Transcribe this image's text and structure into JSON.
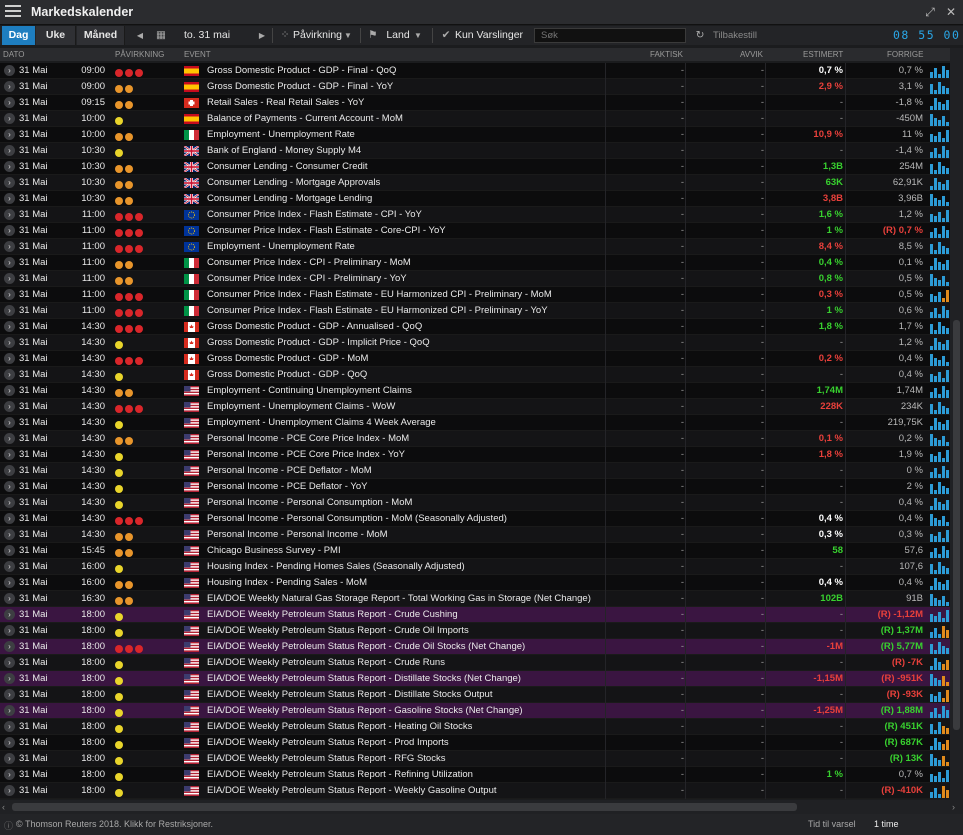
{
  "app": {
    "title": "Markedskalender"
  },
  "toolbar": {
    "views": [
      "Dag",
      "Uke",
      "Måned"
    ],
    "date": "to. 31 mai",
    "impact": "Påvirkning",
    "country": "Land",
    "alerts": "Kun Varslinger",
    "search_placeholder": "Søk",
    "reset": "Tilbakestill",
    "clock": "08 55 00"
  },
  "columns": {
    "date": "DATO",
    "impact": "PÅVIRKNING",
    "event": "EVENT",
    "actual": "FAKTISK",
    "deviation": "AVVIK",
    "estimate": "ESTIMERT",
    "previous": "FORRIGE"
  },
  "colors": {
    "high": "#d9262a",
    "medium": "#e8952b",
    "low": "#e9d52b",
    "positive": "#38d12f",
    "negative": "#e8403b",
    "accent": "#1e7ec0"
  },
  "rows": [
    {
      "date": "31 Mai",
      "time": "09:00",
      "impact": "high",
      "flag": "es",
      "event": "Gross Domestic Product - GDP - Final - QoQ",
      "actual": "-",
      "dev": "-",
      "est": "0,7 %",
      "estc": "w",
      "prev": "0,7 %",
      "prevc": "",
      "spark": "b",
      "hl": false
    },
    {
      "date": "31 Mai",
      "time": "09:00",
      "impact": "medium",
      "flag": "es",
      "event": "Gross Domestic Product - GDP - Final - YoY",
      "actual": "-",
      "dev": "-",
      "est": "2,9 %",
      "estc": "r",
      "prev": "3,1 %",
      "prevc": "",
      "spark": "b",
      "hl": false
    },
    {
      "date": "31 Mai",
      "time": "09:15",
      "impact": "medium",
      "flag": "ch",
      "event": "Retail Sales - Real Retail Sales - YoY",
      "actual": "-",
      "dev": "-",
      "est": "-",
      "estc": "d",
      "prev": "-1,8 %",
      "prevc": "",
      "spark": "b",
      "hl": false
    },
    {
      "date": "31 Mai",
      "time": "10:00",
      "impact": "low",
      "flag": "es",
      "event": "Balance of Payments - Current Account - MoM",
      "actual": "-",
      "dev": "-",
      "est": "-",
      "estc": "d",
      "prev": "-450M",
      "prevc": "",
      "spark": "b",
      "hl": false
    },
    {
      "date": "31 Mai",
      "time": "10:00",
      "impact": "medium",
      "flag": "it",
      "event": "Employment - Unemployment Rate",
      "actual": "-",
      "dev": "-",
      "est": "10,9 %",
      "estc": "r",
      "prev": "11 %",
      "prevc": "",
      "spark": "b",
      "hl": false
    },
    {
      "date": "31 Mai",
      "time": "10:30",
      "impact": "low",
      "flag": "uk",
      "event": "Bank of England - Money Supply M4",
      "actual": "-",
      "dev": "-",
      "est": "-",
      "estc": "d",
      "prev": "-1,4 %",
      "prevc": "",
      "spark": "b",
      "hl": false
    },
    {
      "date": "31 Mai",
      "time": "10:30",
      "impact": "medium",
      "flag": "uk",
      "event": "Consumer Lending - Consumer Credit",
      "actual": "-",
      "dev": "-",
      "est": "1,3B",
      "estc": "g",
      "prev": "254M",
      "prevc": "",
      "spark": "b",
      "hl": false
    },
    {
      "date": "31 Mai",
      "time": "10:30",
      "impact": "medium",
      "flag": "uk",
      "event": "Consumer Lending - Mortgage Approvals",
      "actual": "-",
      "dev": "-",
      "est": "63K",
      "estc": "g",
      "prev": "62,91K",
      "prevc": "",
      "spark": "b",
      "hl": false
    },
    {
      "date": "31 Mai",
      "time": "10:30",
      "impact": "medium",
      "flag": "uk",
      "event": "Consumer Lending - Mortgage Lending",
      "actual": "-",
      "dev": "-",
      "est": "3,8B",
      "estc": "r",
      "prev": "3,96B",
      "prevc": "",
      "spark": "b",
      "hl": false
    },
    {
      "date": "31 Mai",
      "time": "11:00",
      "impact": "high",
      "flag": "eu",
      "event": "Consumer Price Index - Flash Estimate - CPI - YoY",
      "actual": "-",
      "dev": "-",
      "est": "1,6 %",
      "estc": "g",
      "prev": "1,2 %",
      "prevc": "",
      "spark": "b",
      "hl": false
    },
    {
      "date": "31 Mai",
      "time": "11:00",
      "impact": "high",
      "flag": "eu",
      "event": "Consumer Price Index - Flash Estimate - Core-CPI - YoY",
      "actual": "-",
      "dev": "-",
      "est": "1 %",
      "estc": "g",
      "prev": "(R) 0,7 %",
      "prevc": "r",
      "spark": "b",
      "hl": false
    },
    {
      "date": "31 Mai",
      "time": "11:00",
      "impact": "high",
      "flag": "eu",
      "event": "Employment - Unemployment Rate",
      "actual": "-",
      "dev": "-",
      "est": "8,4 %",
      "estc": "r",
      "prev": "8,5 %",
      "prevc": "",
      "spark": "b",
      "hl": false
    },
    {
      "date": "31 Mai",
      "time": "11:00",
      "impact": "medium",
      "flag": "it",
      "event": "Consumer Price Index - CPI - Preliminary - MoM",
      "actual": "-",
      "dev": "-",
      "est": "0,4 %",
      "estc": "g",
      "prev": "0,1 %",
      "prevc": "",
      "spark": "b",
      "hl": false
    },
    {
      "date": "31 Mai",
      "time": "11:00",
      "impact": "medium",
      "flag": "it",
      "event": "Consumer Price Index - CPI - Preliminary - YoY",
      "actual": "-",
      "dev": "-",
      "est": "0,8 %",
      "estc": "g",
      "prev": "0,5 %",
      "prevc": "",
      "spark": "b",
      "hl": false
    },
    {
      "date": "31 Mai",
      "time": "11:00",
      "impact": "high",
      "flag": "it",
      "event": "Consumer Price Index - Flash Estimate - EU Harmonized CPI - Preliminary - MoM",
      "actual": "-",
      "dev": "-",
      "est": "0,3 %",
      "estc": "r",
      "prev": "0,5 %",
      "prevc": "",
      "spark": "o",
      "hl": false
    },
    {
      "date": "31 Mai",
      "time": "11:00",
      "impact": "high",
      "flag": "it",
      "event": "Consumer Price Index - Flash Estimate - EU Harmonized CPI - Preliminary - YoY",
      "actual": "-",
      "dev": "-",
      "est": "1 %",
      "estc": "g",
      "prev": "0,6 %",
      "prevc": "",
      "spark": "b",
      "hl": false
    },
    {
      "date": "31 Mai",
      "time": "14:30",
      "impact": "high",
      "flag": "ca",
      "event": "Gross Domestic Product - GDP - Annualised - QoQ",
      "actual": "-",
      "dev": "-",
      "est": "1,8 %",
      "estc": "g",
      "prev": "1,7 %",
      "prevc": "",
      "spark": "b",
      "hl": false
    },
    {
      "date": "31 Mai",
      "time": "14:30",
      "impact": "low",
      "flag": "ca",
      "event": "Gross Domestic Product - GDP - Implicit Price - QoQ",
      "actual": "-",
      "dev": "-",
      "est": "-",
      "estc": "d",
      "prev": "1,2 %",
      "prevc": "",
      "spark": "b",
      "hl": false
    },
    {
      "date": "31 Mai",
      "time": "14:30",
      "impact": "high",
      "flag": "ca",
      "event": "Gross Domestic Product - GDP - MoM",
      "actual": "-",
      "dev": "-",
      "est": "0,2 %",
      "estc": "r",
      "prev": "0,4 %",
      "prevc": "",
      "spark": "b",
      "hl": false
    },
    {
      "date": "31 Mai",
      "time": "14:30",
      "impact": "low",
      "flag": "ca",
      "event": "Gross Domestic Product - GDP - QoQ",
      "actual": "-",
      "dev": "-",
      "est": "-",
      "estc": "d",
      "prev": "0,4 %",
      "prevc": "",
      "spark": "b",
      "hl": false
    },
    {
      "date": "31 Mai",
      "time": "14:30",
      "impact": "medium",
      "flag": "us",
      "event": "Employment - Continuing Unemployment Claims",
      "actual": "-",
      "dev": "-",
      "est": "1,74M",
      "estc": "g",
      "prev": "1,74M",
      "prevc": "",
      "spark": "b",
      "hl": false
    },
    {
      "date": "31 Mai",
      "time": "14:30",
      "impact": "high",
      "flag": "us",
      "event": "Employment - Unemployment Claims - WoW",
      "actual": "-",
      "dev": "-",
      "est": "228K",
      "estc": "r",
      "prev": "234K",
      "prevc": "",
      "spark": "b",
      "hl": false
    },
    {
      "date": "31 Mai",
      "time": "14:30",
      "impact": "low",
      "flag": "us",
      "event": "Employment - Unemployment Claims 4 Week Average",
      "actual": "-",
      "dev": "-",
      "est": "-",
      "estc": "d",
      "prev": "219,75K",
      "prevc": "",
      "spark": "b",
      "hl": false
    },
    {
      "date": "31 Mai",
      "time": "14:30",
      "impact": "medium",
      "flag": "us",
      "event": "Personal Income - PCE Core Price Index - MoM",
      "actual": "-",
      "dev": "-",
      "est": "0,1 %",
      "estc": "r",
      "prev": "0,2 %",
      "prevc": "",
      "spark": "b",
      "hl": false
    },
    {
      "date": "31 Mai",
      "time": "14:30",
      "impact": "low",
      "flag": "us",
      "event": "Personal Income - PCE Core Price Index - YoY",
      "actual": "-",
      "dev": "-",
      "est": "1,8 %",
      "estc": "r",
      "prev": "1,9 %",
      "prevc": "",
      "spark": "b",
      "hl": false
    },
    {
      "date": "31 Mai",
      "time": "14:30",
      "impact": "low",
      "flag": "us",
      "event": "Personal Income - PCE Deflator - MoM",
      "actual": "-",
      "dev": "-",
      "est": "-",
      "estc": "d",
      "prev": "0 %",
      "prevc": "",
      "spark": "b",
      "hl": false
    },
    {
      "date": "31 Mai",
      "time": "14:30",
      "impact": "low",
      "flag": "us",
      "event": "Personal Income - PCE Deflator - YoY",
      "actual": "-",
      "dev": "-",
      "est": "-",
      "estc": "d",
      "prev": "2 %",
      "prevc": "",
      "spark": "b",
      "hl": false
    },
    {
      "date": "31 Mai",
      "time": "14:30",
      "impact": "low",
      "flag": "us",
      "event": "Personal Income - Personal Consumption - MoM",
      "actual": "-",
      "dev": "-",
      "est": "-",
      "estc": "d",
      "prev": "0,4 %",
      "prevc": "",
      "spark": "b",
      "hl": false
    },
    {
      "date": "31 Mai",
      "time": "14:30",
      "impact": "high",
      "flag": "us",
      "event": "Personal Income - Personal Consumption - MoM (Seasonally Adjusted)",
      "actual": "-",
      "dev": "-",
      "est": "0,4 %",
      "estc": "w",
      "prev": "0,4 %",
      "prevc": "",
      "spark": "b",
      "hl": false
    },
    {
      "date": "31 Mai",
      "time": "14:30",
      "impact": "medium",
      "flag": "us",
      "event": "Personal Income - Personal Income - MoM",
      "actual": "-",
      "dev": "-",
      "est": "0,3 %",
      "estc": "w",
      "prev": "0,3 %",
      "prevc": "",
      "spark": "b",
      "hl": false
    },
    {
      "date": "31 Mai",
      "time": "15:45",
      "impact": "medium",
      "flag": "us",
      "event": "Chicago Business Survey - PMI",
      "actual": "-",
      "dev": "-",
      "est": "58",
      "estc": "g",
      "prev": "57,6",
      "prevc": "",
      "spark": "b",
      "hl": false
    },
    {
      "date": "31 Mai",
      "time": "16:00",
      "impact": "low",
      "flag": "us",
      "event": "Housing Index - Pending Homes Sales (Seasonally Adjusted)",
      "actual": "-",
      "dev": "-",
      "est": "-",
      "estc": "d",
      "prev": "107,6",
      "prevc": "",
      "spark": "b",
      "hl": false
    },
    {
      "date": "31 Mai",
      "time": "16:00",
      "impact": "medium",
      "flag": "us",
      "event": "Housing Index - Pending Sales - MoM",
      "actual": "-",
      "dev": "-",
      "est": "0,4 %",
      "estc": "w",
      "prev": "0,4 %",
      "prevc": "",
      "spark": "b",
      "hl": false
    },
    {
      "date": "31 Mai",
      "time": "16:30",
      "impact": "medium",
      "flag": "us",
      "event": "EIA/DOE Weekly Natural Gas Storage Report - Total Working Gas in Storage (Net Change)",
      "actual": "-",
      "dev": "-",
      "est": "102B",
      "estc": "g",
      "prev": "91B",
      "prevc": "",
      "spark": "b",
      "hl": false
    },
    {
      "date": "31 Mai",
      "time": "18:00",
      "impact": "low",
      "flag": "us",
      "event": "EIA/DOE Weekly Petroleum Status Report - Crude Cushing",
      "actual": "-",
      "dev": "-",
      "est": "-",
      "estc": "d",
      "prev": "(R) -1,12M",
      "prevc": "r",
      "spark": "b",
      "hl": true
    },
    {
      "date": "31 Mai",
      "time": "18:00",
      "impact": "low",
      "flag": "us",
      "event": "EIA/DOE Weekly Petroleum Status Report - Crude Oil Imports",
      "actual": "-",
      "dev": "-",
      "est": "-",
      "estc": "d",
      "prev": "(R) 1,37M",
      "prevc": "g",
      "spark": "o",
      "hl": false
    },
    {
      "date": "31 Mai",
      "time": "18:00",
      "impact": "high",
      "flag": "us",
      "event": "EIA/DOE Weekly Petroleum Status Report - Crude Oil Stocks (Net Change)",
      "actual": "-",
      "dev": "-",
      "est": "-1M",
      "estc": "r",
      "prev": "(R) 5,77M",
      "prevc": "g",
      "spark": "b",
      "hl": true
    },
    {
      "date": "31 Mai",
      "time": "18:00",
      "impact": "low",
      "flag": "us",
      "event": "EIA/DOE Weekly Petroleum Status Report - Crude Runs",
      "actual": "-",
      "dev": "-",
      "est": "-",
      "estc": "d",
      "prev": "(R) -7K",
      "prevc": "r",
      "spark": "o",
      "hl": false
    },
    {
      "date": "31 Mai",
      "time": "18:00",
      "impact": "low",
      "flag": "us",
      "event": "EIA/DOE Weekly Petroleum Status Report - Distillate Stocks (Net Change)",
      "actual": "-",
      "dev": "-",
      "est": "-1,15M",
      "estc": "r",
      "prev": "(R) -951K",
      "prevc": "r",
      "spark": "o",
      "hl": true
    },
    {
      "date": "31 Mai",
      "time": "18:00",
      "impact": "low",
      "flag": "us",
      "event": "EIA/DOE Weekly Petroleum Status Report - Distillate Stocks Output",
      "actual": "-",
      "dev": "-",
      "est": "-",
      "estc": "d",
      "prev": "(R) -93K",
      "prevc": "r",
      "spark": "o",
      "hl": false
    },
    {
      "date": "31 Mai",
      "time": "18:00",
      "impact": "low",
      "flag": "us",
      "event": "EIA/DOE Weekly Petroleum Status Report - Gasoline Stocks (Net Change)",
      "actual": "-",
      "dev": "-",
      "est": "-1,25M",
      "estc": "r",
      "prev": "(R) 1,88M",
      "prevc": "g",
      "spark": "b",
      "hl": true
    },
    {
      "date": "31 Mai",
      "time": "18:00",
      "impact": "low",
      "flag": "us",
      "event": "EIA/DOE Weekly Petroleum Status Report - Heating Oil Stocks",
      "actual": "-",
      "dev": "-",
      "est": "-",
      "estc": "d",
      "prev": "(R) 451K",
      "prevc": "g",
      "spark": "o",
      "hl": false
    },
    {
      "date": "31 Mai",
      "time": "18:00",
      "impact": "low",
      "flag": "us",
      "event": "EIA/DOE Weekly Petroleum Status Report - Prod Imports",
      "actual": "-",
      "dev": "-",
      "est": "-",
      "estc": "d",
      "prev": "(R) 687K",
      "prevc": "g",
      "spark": "o",
      "hl": false
    },
    {
      "date": "31 Mai",
      "time": "18:00",
      "impact": "low",
      "flag": "us",
      "event": "EIA/DOE Weekly Petroleum Status Report - RFG Stocks",
      "actual": "-",
      "dev": "-",
      "est": "-",
      "estc": "d",
      "prev": "(R) 13K",
      "prevc": "g",
      "spark": "o",
      "hl": false
    },
    {
      "date": "31 Mai",
      "time": "18:00",
      "impact": "low",
      "flag": "us",
      "event": "EIA/DOE Weekly Petroleum Status Report - Refining Utilization",
      "actual": "-",
      "dev": "-",
      "est": "1 %",
      "estc": "g",
      "prev": "0,7 %",
      "prevc": "",
      "spark": "b",
      "hl": false
    },
    {
      "date": "31 Mai",
      "time": "18:00",
      "impact": "low",
      "flag": "us",
      "event": "EIA/DOE Weekly Petroleum Status Report - Weekly Gasoline Output",
      "actual": "-",
      "dev": "-",
      "est": "-",
      "estc": "d",
      "prev": "(R) -410K",
      "prevc": "r",
      "spark": "o",
      "hl": false
    }
  ],
  "footer": {
    "copyright": "© Thomson Reuters 2018. Klikk for Restriksjoner.",
    "alert_label": "Tid til varsel",
    "alert_value": "1 time"
  }
}
